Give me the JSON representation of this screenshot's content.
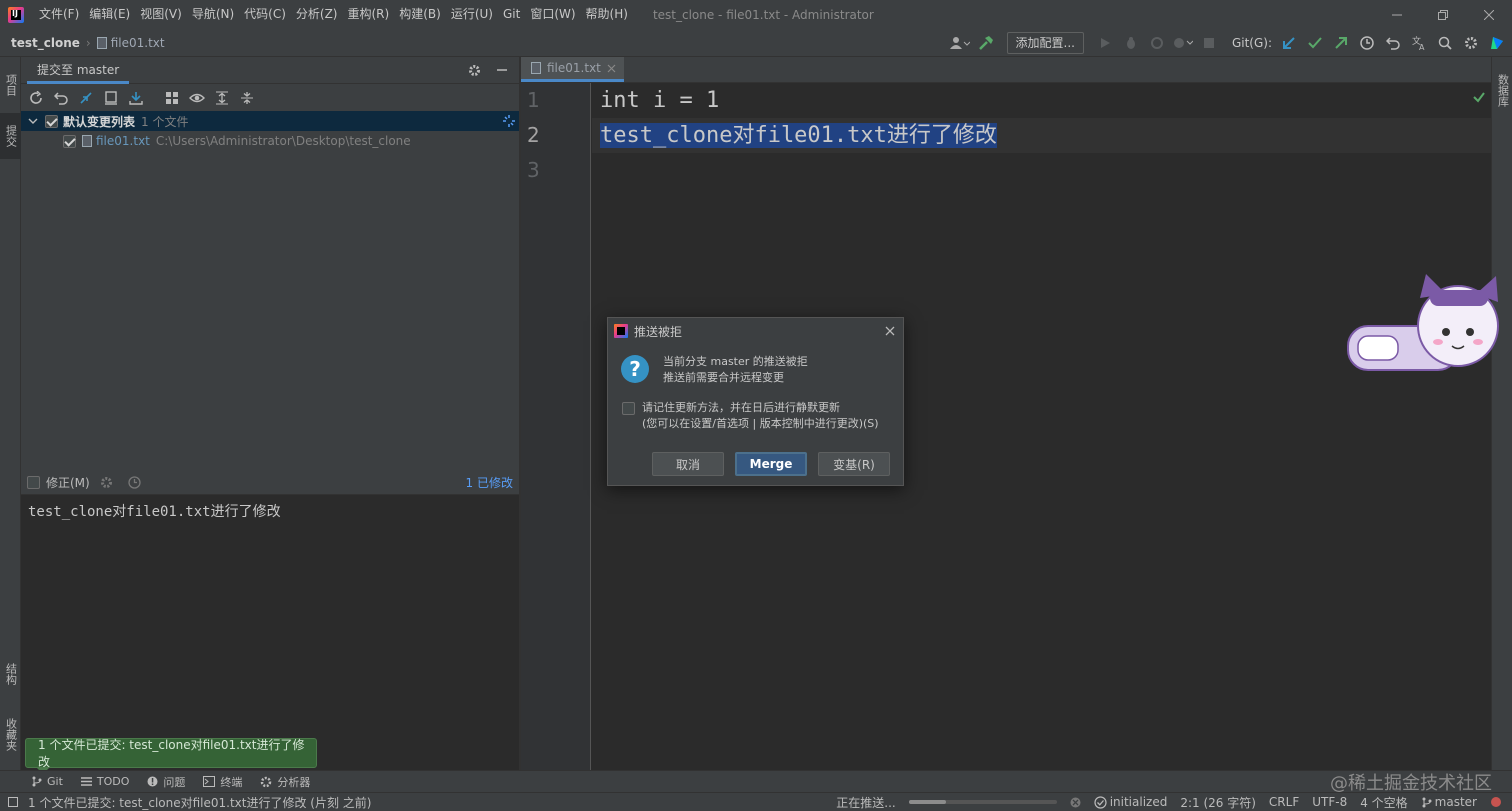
{
  "app": {
    "window_title": "test_clone - file01.txt - Administrator",
    "menu": [
      "文件(F)",
      "编辑(E)",
      "视图(V)",
      "导航(N)",
      "代码(C)",
      "分析(Z)",
      "重构(R)",
      "构建(B)",
      "运行(U)",
      "Git",
      "窗口(W)",
      "帮助(H)"
    ]
  },
  "nav": {
    "project": "test_clone",
    "file": "file01.txt",
    "add_config": "添加配置...",
    "git_label": "Git(G):"
  },
  "left_stripe": {
    "project_tab": "项目",
    "commit_tab": "提交",
    "structure_tab": "结构",
    "favorites_tab": "收藏夹"
  },
  "right_stripe": {
    "database_tab": "数据库"
  },
  "commit_panel": {
    "tab_label": "提交至 master",
    "changelist": {
      "name": "默认变更列表",
      "count": "1 个文件",
      "checked": true
    },
    "files": [
      {
        "name": "file01.txt",
        "path": "C:\\Users\\Administrator\\Desktop\\test_clone",
        "checked": true
      }
    ],
    "amend_label": "修正(M)",
    "modified_count": "1 已修改",
    "message": "test_clone对file01.txt进行了修改"
  },
  "editor": {
    "tab": "file01.txt",
    "line_numbers": [
      "1",
      "2",
      "3"
    ],
    "lines": [
      "int i = 1",
      "test_clone对file01.txt进行了修改",
      ""
    ]
  },
  "dialog": {
    "title": "推送被拒",
    "message_line1": "当前分支 master 的推送被拒",
    "message_line2": "推送前需要合并远程变更",
    "remember_line1": "请记住更新方法，并在日后进行静默更新",
    "remember_line2": "(您可以在设置/首选项 | 版本控制中进行更改)(S)",
    "remember_checked": false,
    "buttons": {
      "cancel": "取消",
      "merge": "Merge",
      "rebase": "变基(R)"
    }
  },
  "bottom_tools": [
    "Git",
    "TODO",
    "问题",
    "终端",
    "分析器"
  ],
  "watermark": "@稀土掘金技术社区",
  "notification": "1 个文件已提交: test_clone对file01.txt进行了修改",
  "status": {
    "message": "1 个文件已提交: test_clone对file01.txt进行了修改 (片刻 之前)",
    "task": "正在推送...",
    "progress": 0.25,
    "vcs_state": "initialized",
    "position": "2:1 (26 字符)",
    "line_sep": "CRLF",
    "encoding": "UTF-8",
    "indent": "4 个空格",
    "branch": "master"
  },
  "colors": {
    "accent": "#4a88c7",
    "selection": "#214283",
    "dialog_default": "#365880",
    "notification_bg": "#356336"
  }
}
